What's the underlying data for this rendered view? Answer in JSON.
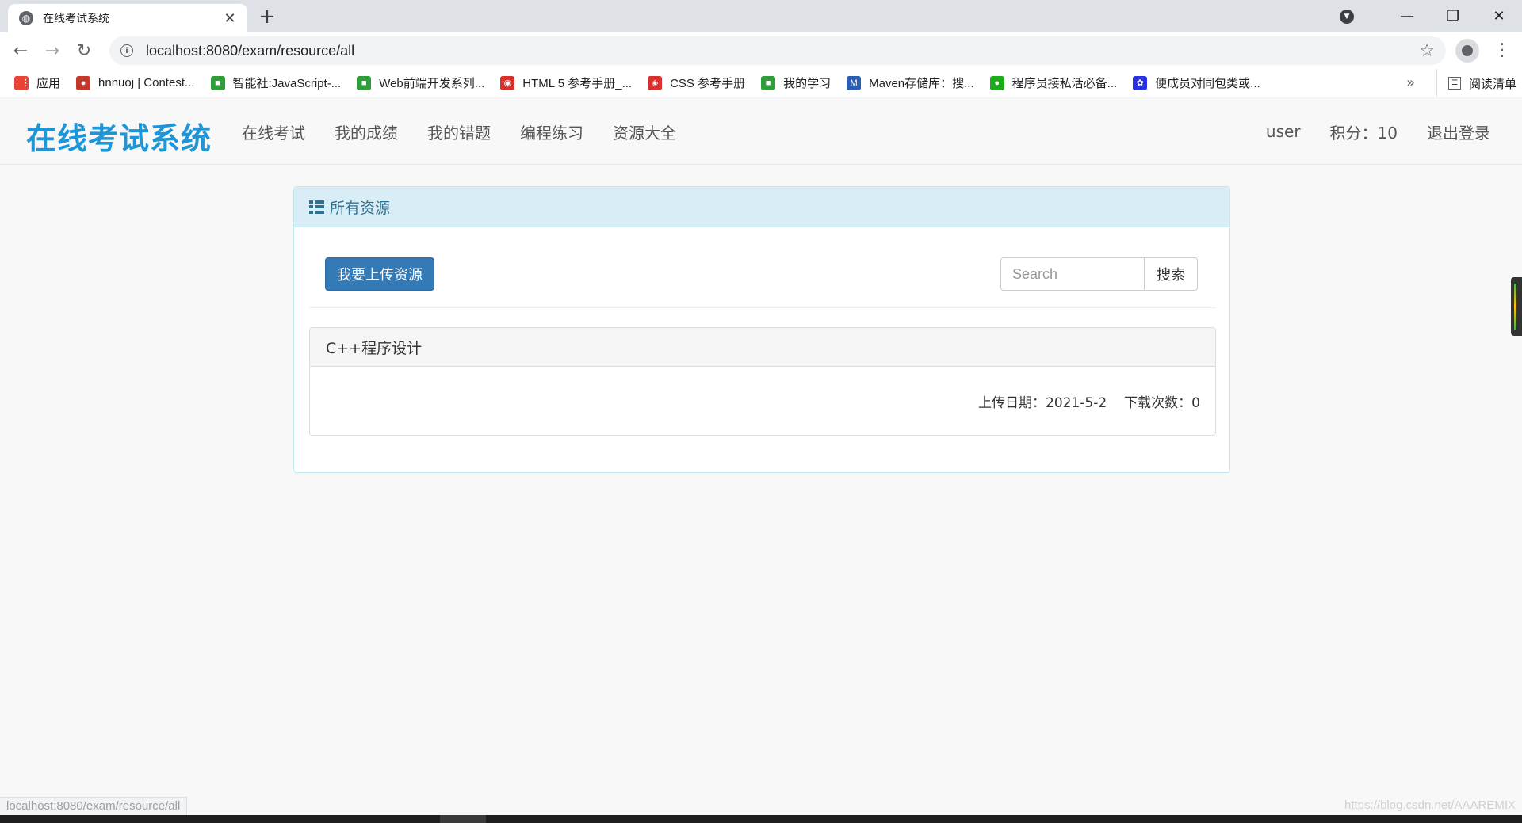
{
  "browser": {
    "tab_title": "在线考试系统",
    "url": "localhost:8080/exam/resource/all",
    "bookmarks": [
      {
        "label": "应用",
        "icon": "apps-grid-icon",
        "color": "#ea4335"
      },
      {
        "label": "hnnuoj | Contest...",
        "icon": "balloon-icon",
        "color": "#c0392b"
      },
      {
        "label": "智能社:JavaScript-...",
        "icon": "bookmark-green-icon",
        "color": "#2e9d3a"
      },
      {
        "label": "Web前端开发系列...",
        "icon": "bookmark-green-icon",
        "color": "#2e9d3a"
      },
      {
        "label": "HTML 5 参考手册_...",
        "icon": "owl-icon",
        "color": "#d9302c"
      },
      {
        "label": "CSS 参考手册",
        "icon": "css-logo-icon",
        "color": "#d9302c"
      },
      {
        "label": "我的学习",
        "icon": "bookmark-green-icon",
        "color": "#2e9d3a"
      },
      {
        "label": "Maven存储库：搜...",
        "icon": "mvn-icon",
        "color": "#2a5db0"
      },
      {
        "label": "程序员接私活必备...",
        "icon": "wechat-icon",
        "color": "#1aad19"
      },
      {
        "label": "便成员对同包类或...",
        "icon": "baidu-paw-icon",
        "color": "#2932e1"
      }
    ],
    "more": "»",
    "reading_list": "阅读清单",
    "status_url": "localhost:8080/exam/resource/all",
    "watermark": "https://blog.csdn.net/AAAREMIX"
  },
  "site": {
    "brand": "在线考试系统",
    "nav": [
      "在线考试",
      "我的成绩",
      "我的错题",
      "编程练习",
      "资源大全"
    ],
    "user": "user",
    "points": "积分：10",
    "logout": "退出登录"
  },
  "panel": {
    "title": "所有资源",
    "upload_label": "我要上传资源",
    "search_placeholder": "Search",
    "search_button": "搜索"
  },
  "resources": [
    {
      "name": "C++程序设计",
      "upload_date": "上传日期：2021-5-2",
      "downloads": "下载次数：0"
    }
  ],
  "colors": {
    "brand": "#1d95d6",
    "primary": "#337ab7",
    "info_bg": "#d9edf7",
    "info_text": "#31708f"
  }
}
